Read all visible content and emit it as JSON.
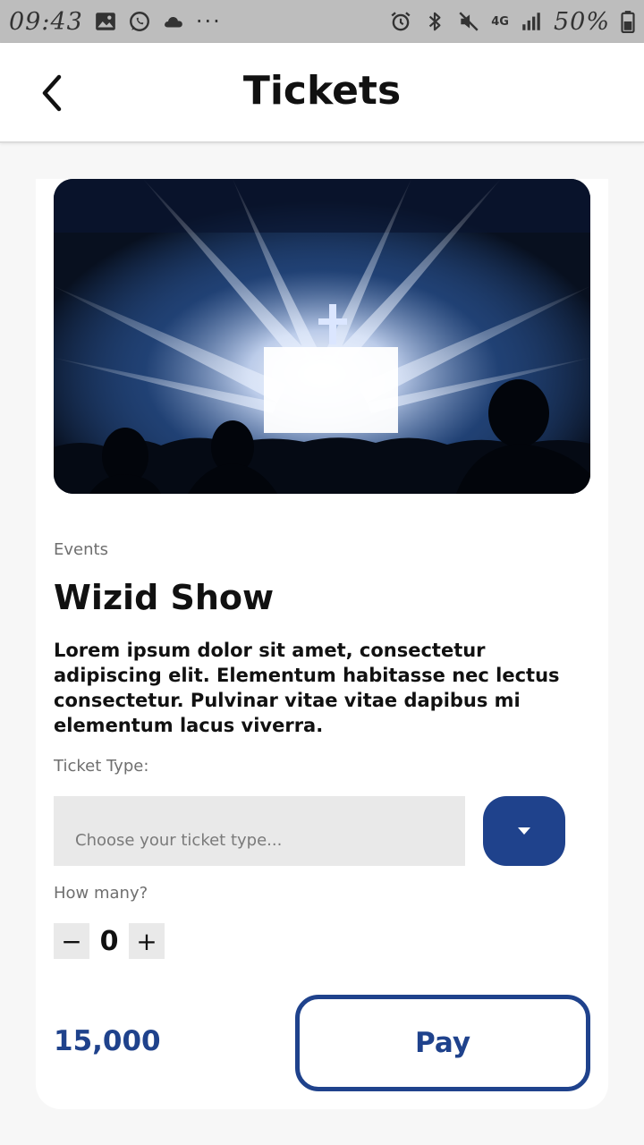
{
  "status_bar": {
    "time": "09:43",
    "dots": "···",
    "network": "4G",
    "battery": "50%"
  },
  "header": {
    "title": "Tickets"
  },
  "event": {
    "category": "Events",
    "title": "Wizid Show",
    "description": "Lorem ipsum dolor sit amet, consectetur adipiscing elit. Elementum habitasse nec lectus consectetur. Pulvinar vitae vitae dapibus mi elementum lacus viverra."
  },
  "ticket_type": {
    "label": "Ticket Type:",
    "placeholder": "Choose your ticket type..."
  },
  "quantity": {
    "label": "How many?",
    "minus": "−",
    "value": "0",
    "plus": "+"
  },
  "checkout": {
    "price": "15,000",
    "pay_label": "Pay"
  },
  "colors": {
    "accent": "#1f428c",
    "status_bar": "#bdbdbd",
    "input_bg": "#e9e9e9"
  },
  "icons": {
    "back": "chevron-left-icon",
    "dropdown": "caret-down-icon"
  }
}
